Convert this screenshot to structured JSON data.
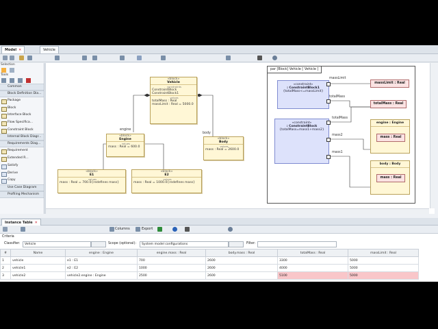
{
  "tabs": [
    {
      "label": "Model"
    },
    {
      "label": "Vehicle"
    }
  ],
  "sidebar": {
    "selection_label": "Selection",
    "tools_label": "Tools",
    "common_label": "Common",
    "items": [
      {
        "label": "Block Definition Dia..."
      },
      {
        "label": "Package"
      },
      {
        "label": "Block"
      },
      {
        "label": "Interface Block"
      },
      {
        "label": "Flow Specifica..."
      },
      {
        "label": "Constraint Block"
      },
      {
        "label": "Internal Block Diagr..."
      },
      {
        "label": "Requirements Diag..."
      },
      {
        "label": "Requirement"
      },
      {
        "label": "Extended R..."
      },
      {
        "label": "Satisfy"
      },
      {
        "label": "Derive"
      },
      {
        "label": "Copy"
      },
      {
        "label": "Use Case Diagram"
      },
      {
        "label": "Profiling Mechanism"
      }
    ]
  },
  "bdd": {
    "vehicle": {
      "stereo": "«block»",
      "name": "Vehicle",
      "constraints_stereo": "constraints",
      "c1": "ConstraintBlock",
      "c2": "ConstraintBlock1",
      "values_stereo": "values",
      "v1": "totalMass : Real",
      "v2": "massLimit : Real = 5000.0"
    },
    "engine": {
      "stereo": "«block»",
      "name": "Engine",
      "values_stereo": "values",
      "v1": "mass : Real = 600.0"
    },
    "body": {
      "stereo": "«block»",
      "name": "Body",
      "values_stereo": "values",
      "v1": "mass : Real = 2600.0"
    },
    "e1": {
      "stereo": "«block»",
      "name": "E1",
      "values_stereo": "values",
      "v1": "mass : Real = 700.0{redefines mass}"
    },
    "e2": {
      "stereo": "«block»",
      "name": "E2",
      "values_stereo": "values",
      "v1": "mass : Real = 1000.0{redefines mass}"
    },
    "role_engine": "engine",
    "role_body": "body"
  },
  "par": {
    "title": "par [Block] Vehicle [",
    "title_ref": "Vehicle ]",
    "cb1": {
      "stereo": "«constraint»",
      "name": ": ConstraintBlock1",
      "expr": "{totalMass<=massLimit}",
      "p1": "massLimit",
      "p2": "totalMass"
    },
    "cb2": {
      "stereo": "«constraint»",
      "name": ": ConstraintBlock",
      "expr": "{totalMass=mass1+mass2}",
      "p1": "totalMass",
      "p2": "mass2",
      "p3": "mass1"
    },
    "massLimit": "massLimit : Real",
    "totalMass": "totalMass : Real",
    "engine_part": "engine : Engine",
    "body_part": "body : Body",
    "engine_mass": "mass : Real",
    "body_mass": "mass : Real"
  },
  "instance": {
    "tab_label": "Instance Table",
    "criteria_label": "Criteria",
    "classifier_label": "Classifier:",
    "classifier_value": "Vehicle",
    "scope_label": "Scope (optional):",
    "scope_value": "System model configurations",
    "filter_label": "Filter:",
    "columns_label": "Columns",
    "export_label": "Export",
    "headers": [
      "#",
      "Name",
      "engine : Engine",
      "engine.mass : Real",
      "body.mass : Real",
      "totalMass : Real",
      "massLimit : Real"
    ],
    "rows": [
      [
        "1",
        "vehicle",
        "e1 : E1",
        "700",
        "2600",
        "3300",
        "5000"
      ],
      [
        "2",
        "vehicle1",
        "e2 : E2",
        "1000",
        "2600",
        "4000",
        "5000"
      ],
      [
        "3",
        "vehicle2",
        "vehicle2.engine : Engine",
        "2500",
        "2600",
        "5100",
        "5000"
      ]
    ]
  },
  "colors": {
    "block_fill": "#fff7d6",
    "constraint_fill": "#dde2fb",
    "violation": "#f9c6c9"
  }
}
